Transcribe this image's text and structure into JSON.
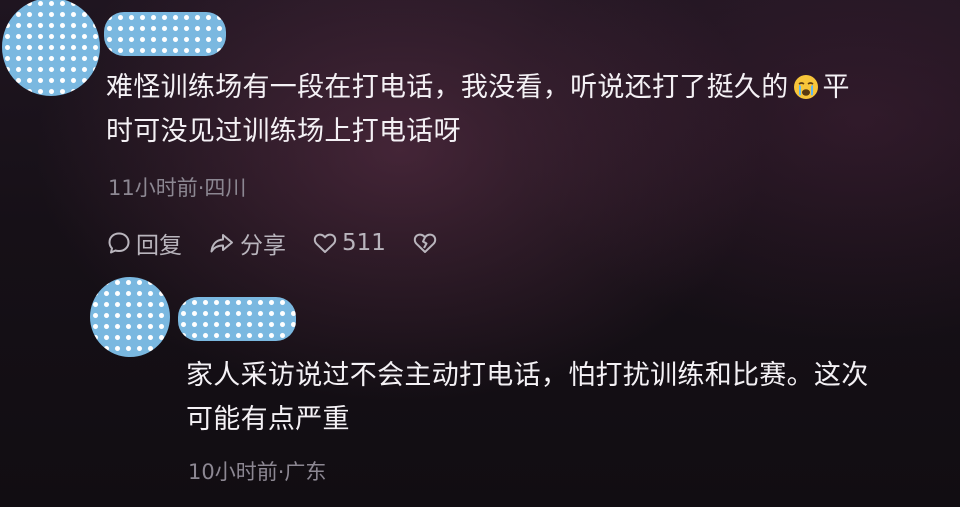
{
  "comments": [
    {
      "text_line1": "难怪训练场有一段在打电话，我没看，听说还打了挺久的",
      "text_line1_end": "平",
      "text_line2": "时可没见过训练场上打电话呀",
      "emoji": "crying-face",
      "meta": "11小时前·四川",
      "actions": {
        "reply": "回复",
        "share": "分享",
        "likes": "511"
      }
    },
    {
      "text_line1": "家人采访说过不会主动打电话，怕打扰训练和比赛。这次",
      "text_line2": "可能有点严重",
      "meta": "10小时前·广东"
    }
  ]
}
